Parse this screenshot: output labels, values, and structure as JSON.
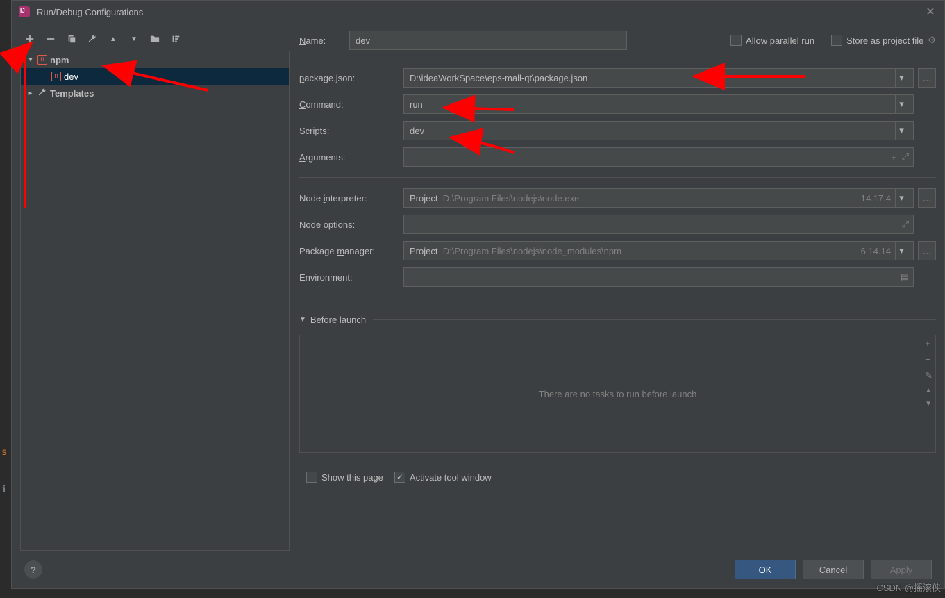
{
  "window": {
    "title": "Run/Debug Configurations"
  },
  "tree": {
    "npm_label": "npm",
    "dev_label": "dev",
    "templates_label": "Templates"
  },
  "form": {
    "name_label_pre": "N",
    "name_label_post": "ame:",
    "name_value": "dev",
    "allow_parallel_pre": "Allow parallel r",
    "allow_parallel_u": "u",
    "allow_parallel_post": "n",
    "store_pre": "S",
    "store_post": "tore as project file",
    "package_json_label_pre": "p",
    "package_json_label_post": "ackage.json:",
    "package_json_value": "D:\\ideaWorkSpace\\eps-mall-qt\\package.json",
    "command_label_pre": "C",
    "command_label_post": "ommand:",
    "command_value": "run",
    "scripts_label_pre": "Scrip",
    "scripts_label_u": "t",
    "scripts_label_post": "s:",
    "scripts_value": "dev",
    "arguments_label_pre": "A",
    "arguments_label_post": "rguments:",
    "arguments_value": "",
    "node_int_label_pre": "Node ",
    "node_int_label_u": "i",
    "node_int_label_post": "nterpreter:",
    "node_int_prefix": "Project",
    "node_int_path": "D:\\Program Files\\nodejs\\node.exe",
    "node_int_version": "14.17.4",
    "node_opt_label": "Node options:",
    "node_opt_value": "",
    "pkg_mgr_label_pre": "Package ",
    "pkg_mgr_label_u": "m",
    "pkg_mgr_label_post": "anager:",
    "pkg_mgr_prefix": "Project",
    "pkg_mgr_path": "D:\\Program Files\\nodejs\\node_modules\\npm",
    "pkg_mgr_version": "6.14.14",
    "env_label": "Environment:",
    "env_value": "",
    "before_launch_label_pre": "B",
    "before_launch_label_post": "efore launch",
    "no_tasks_msg": "There are no tasks to run before launch",
    "show_page_label": "Show this page",
    "activate_tool_label": "Activate tool window"
  },
  "footer": {
    "ok": "OK",
    "cancel": "Cancel",
    "apply": "Apply"
  },
  "watermark": "CSDN @摇滚侠",
  "bg": {
    "s": "s",
    "i": "i"
  }
}
